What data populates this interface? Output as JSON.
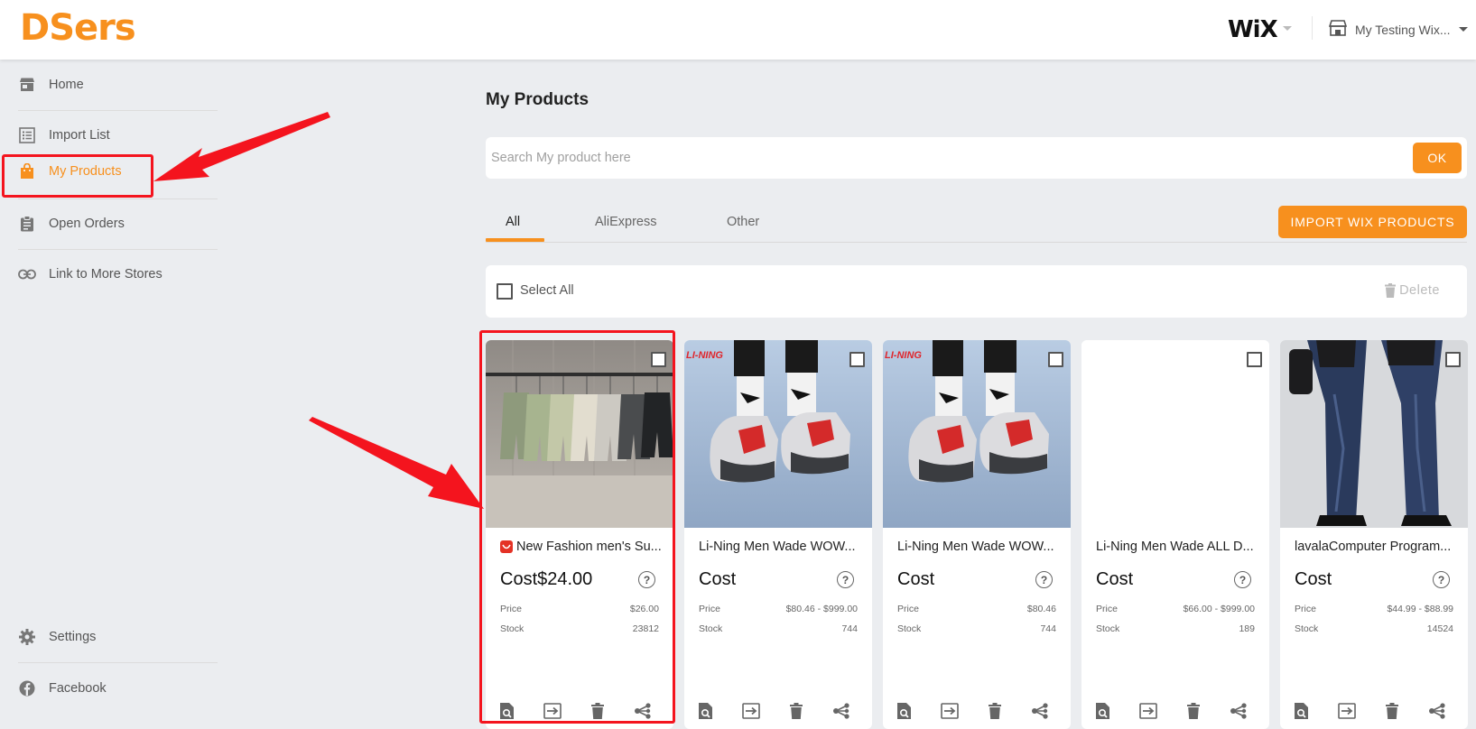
{
  "app": {
    "logo": "DSers",
    "platform_logo": "WiX",
    "store_name": "My Testing Wix..."
  },
  "sidebar": {
    "items": [
      {
        "label": "Home",
        "icon": "store-icon"
      },
      {
        "label": "Import List",
        "icon": "list-icon"
      },
      {
        "label": "My Products",
        "icon": "shopping-bag-icon",
        "active": true
      },
      {
        "label": "Open Orders",
        "icon": "clipboard-icon"
      },
      {
        "label": "Link to More Stores",
        "icon": "link-icon"
      }
    ],
    "bottom_items": [
      {
        "label": "Settings",
        "icon": "gear-icon"
      },
      {
        "label": "Facebook",
        "icon": "facebook-icon"
      }
    ]
  },
  "main": {
    "title": "My Products",
    "search": {
      "placeholder": "Search My product here",
      "value": "",
      "button": "OK"
    },
    "tabs": [
      {
        "label": "All",
        "active": true
      },
      {
        "label": "AliExpress"
      },
      {
        "label": "Other"
      }
    ],
    "import_button": "IMPORT WIX PRODUCTS",
    "select_all": "Select All",
    "delete": "Delete"
  },
  "products": [
    {
      "title": "New Fashion men's Su...",
      "cost": "Cost$24.00",
      "price_label": "Price",
      "price": "$26.00",
      "stock_label": "Stock",
      "stock": "23812",
      "source_badge": "aliexpress-icon",
      "image": "shorts-on-rack"
    },
    {
      "title": "Li-Ning Men Wade WOW...",
      "cost": "Cost",
      "price_label": "Price",
      "price": "$80.46 - $999.00",
      "stock_label": "Stock",
      "stock": "744",
      "image": "sneakers",
      "image_brand_text": "LI-NING"
    },
    {
      "title": "Li-Ning Men Wade WOW...",
      "cost": "Cost",
      "price_label": "Price",
      "price": "$80.46",
      "stock_label": "Stock",
      "stock": "744",
      "image": "sneakers",
      "image_brand_text": "LI-NING"
    },
    {
      "title": "Li-Ning Men Wade ALL D...",
      "cost": "Cost",
      "price_label": "Price",
      "price": "$66.00 - $999.00",
      "stock_label": "Stock",
      "stock": "189",
      "image": "blank"
    },
    {
      "title": "lavalaComputer Program...",
      "cost": "Cost",
      "price_label": "Price",
      "price": "$44.99 - $88.99",
      "stock_label": "Stock",
      "stock": "14524",
      "image": "jeans"
    }
  ],
  "card_actions": [
    "search-doc-icon",
    "transfer-icon",
    "trash-icon",
    "share-icon"
  ],
  "colors": {
    "accent": "#f7901e",
    "annotation": "#f4141e",
    "background": "#ebedf0"
  }
}
